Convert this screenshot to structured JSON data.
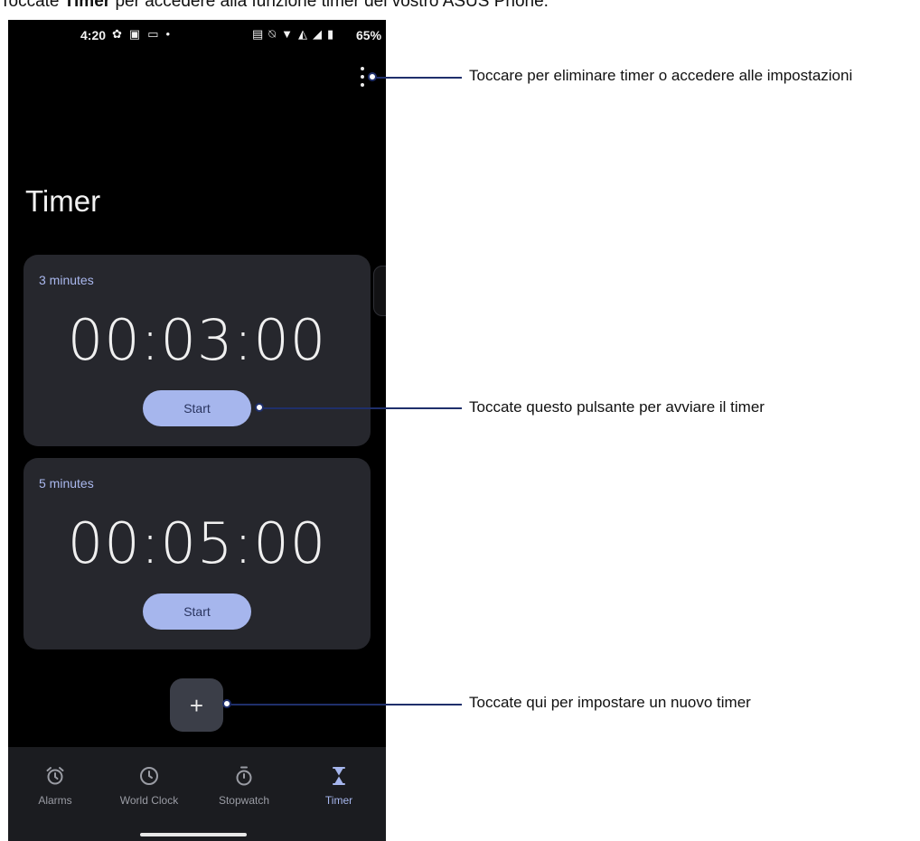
{
  "caption": {
    "prefix": "Toccate ",
    "bold": "Timer",
    "suffix": " per accedere alla funzione timer del vostro ASUS Phone."
  },
  "status_bar": {
    "time": "4:20",
    "battery": "65%",
    "left_icons": [
      "gear-icon",
      "image-icon",
      "gallery-icon",
      "dot-icon"
    ],
    "right_icons": [
      "auto-icon",
      "mute-icon",
      "wifi-icon",
      "volte-icon",
      "signal-icon",
      "battery-icon"
    ]
  },
  "app": {
    "title": "Timer",
    "accent": "#a6b6ed"
  },
  "timers": [
    {
      "label": "3 minutes",
      "time": "00:03:00",
      "button": "Start"
    },
    {
      "label": "5 minutes",
      "time": "00:05:00",
      "button": "Start"
    }
  ],
  "fab": {
    "label": "+"
  },
  "nav": [
    {
      "label": "Alarms",
      "icon": "alarm-icon"
    },
    {
      "label": "World Clock",
      "icon": "clock-icon"
    },
    {
      "label": "Stopwatch",
      "icon": "stopwatch-icon"
    },
    {
      "label": "Timer",
      "icon": "hourglass-icon",
      "active": true
    }
  ],
  "callouts": [
    "Toccare per eliminare timer o accedere alle impostazioni",
    "Toccate questo pulsante per avviare il timer",
    "Toccate qui per impostare un nuovo timer"
  ]
}
